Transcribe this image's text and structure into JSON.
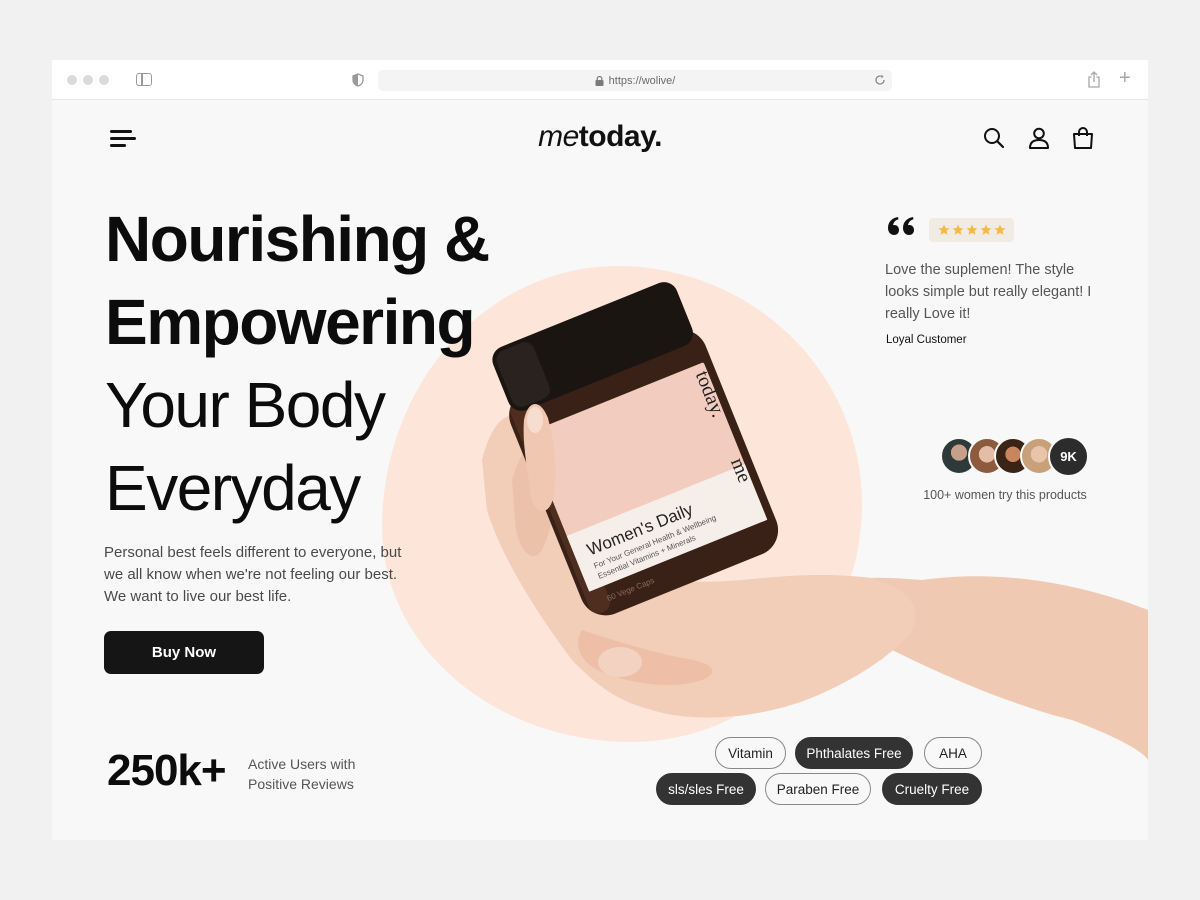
{
  "browser": {
    "url": "https://wolive/"
  },
  "header": {
    "logo_light": "me",
    "logo_bold": "today."
  },
  "hero": {
    "title_line1": "Nourishing &",
    "title_line2": "Empowering",
    "title_line3": "Your Body",
    "title_line4": "Everyday",
    "description": "Personal best feels different to everyone, but we all know when we're not feeling our best. We want to live our best life.",
    "buy_label": "Buy Now"
  },
  "stats": {
    "value": "250k+",
    "label": "Active Users with Positive Reviews"
  },
  "product": {
    "label_title": "Women's Daily",
    "label_line1": "For Your General Health & Wellbeing",
    "label_line2": "Essential Vitamins + Minerals",
    "label_line3": "60 Vege Caps",
    "brand_vertical": "today.",
    "brand_side": "me"
  },
  "review": {
    "rating": 5,
    "text": "Love the suplemen! The style looks simple but really elegant! I really Love it!",
    "author": "Loyal Customer"
  },
  "community": {
    "count_badge": "9K",
    "caption": "100+ women try this products"
  },
  "tags": [
    {
      "label": "Vitamin",
      "style": "outline"
    },
    {
      "label": "Phthalates Free",
      "style": "filled"
    },
    {
      "label": "AHA",
      "style": "outline"
    },
    {
      "label": "sls/sles Free",
      "style": "filled"
    },
    {
      "label": "Paraben Free",
      "style": "outline"
    },
    {
      "label": "Cruelty Free",
      "style": "filled"
    }
  ],
  "colors": {
    "accent_blob": "#fde5d9",
    "button_dark": "#151515",
    "star": "#f4b942",
    "tag_dark": "#333333"
  }
}
